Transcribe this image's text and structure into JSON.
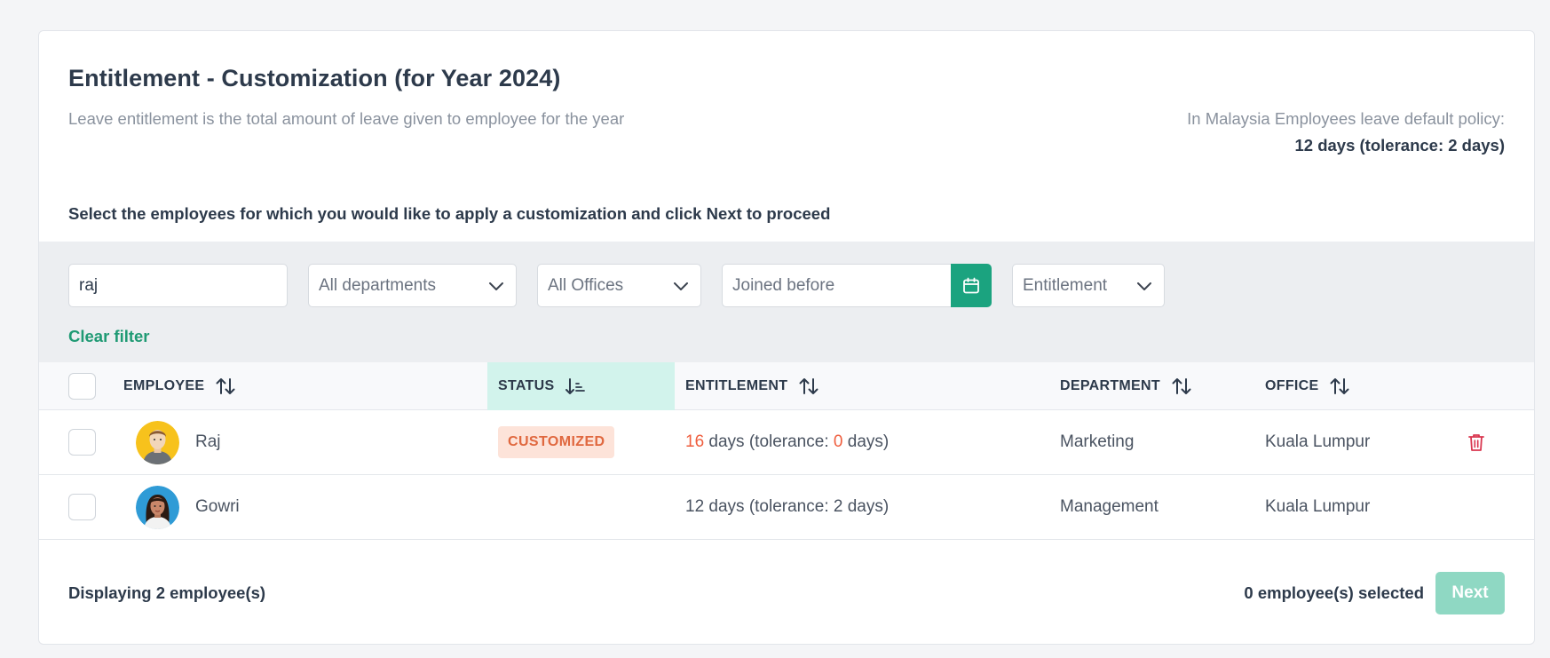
{
  "header": {
    "title": "Entitlement - Customization (for Year 2024)",
    "subtitle": "Leave entitlement is the total amount of leave given to employee for the year",
    "policy_label": "In Malaysia Employees leave default policy:",
    "policy_value": "12 days (tolerance: 2 days)"
  },
  "instruction": "Select the employees for which you would like to apply a customization and click Next to proceed",
  "filters": {
    "search_value": "raj",
    "department": "All departments",
    "office": "All Offices",
    "joined_placeholder": "Joined before",
    "entitlement": "Entitlement",
    "clear_label": "Clear filter"
  },
  "table": {
    "columns": {
      "employee": "EMPLOYEE",
      "status": "STATUS",
      "entitlement": "ENTITLEMENT",
      "department": "DEPARTMENT",
      "office": "OFFICE"
    },
    "rows": [
      {
        "name": "Raj",
        "status": "CUSTOMIZED",
        "ent_days": "16",
        "ent_tolerance": "0",
        "ent_prefix": " days (tolerance: ",
        "ent_suffix": " days)",
        "department": "Marketing",
        "office": "Kuala Lumpur"
      },
      {
        "name": "Gowri",
        "status": "",
        "entitlement": "12 days (tolerance: 2 days)",
        "department": "Management",
        "office": "Kuala Lumpur"
      }
    ]
  },
  "footer": {
    "displaying": "Displaying 2 employee(s)",
    "selected": "0 employee(s) selected",
    "next_label": "Next"
  },
  "colors": {
    "accent": "#1ba37f",
    "status_bg": "#d2f3ec",
    "badge_bg": "#fde3d9",
    "badge_text": "#e0683f",
    "delete": "#d9364f",
    "next_disabled": "#8fd8c3"
  }
}
